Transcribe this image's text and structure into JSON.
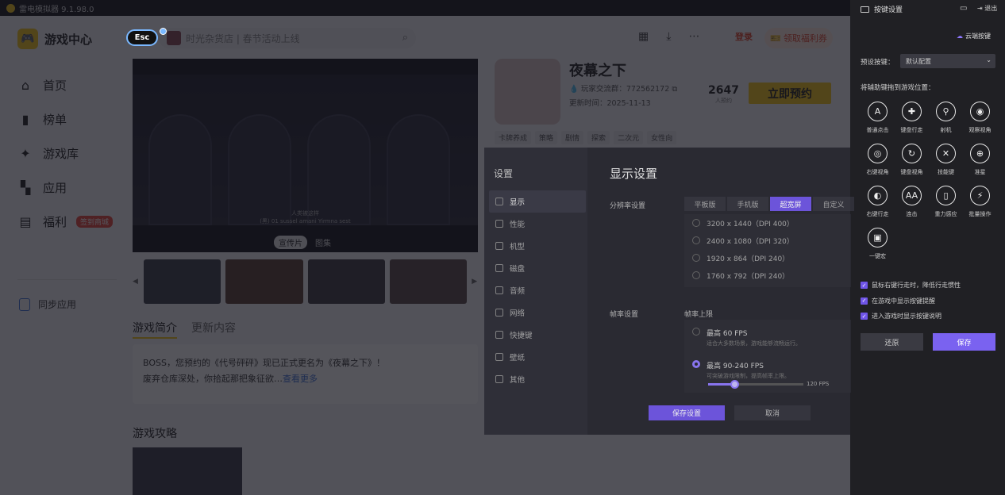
{
  "window": {
    "title": "雷电模拟器 9.1.98.0"
  },
  "header": {
    "brand": "游戏中心",
    "esc": "Esc",
    "search_placeholder": "时光杂货店 | 春节活动上线",
    "login": "登录",
    "welfare": "领取福利券"
  },
  "nav": {
    "items": [
      {
        "label": "首页",
        "icon": "home-icon"
      },
      {
        "label": "榜单",
        "icon": "ranking-icon"
      },
      {
        "label": "游戏库",
        "icon": "gamepad-icon"
      },
      {
        "label": "应用",
        "icon": "apps-icon"
      },
      {
        "label": "福利",
        "icon": "gift-icon",
        "badge": "签到商城"
      }
    ],
    "sync": "同步应用"
  },
  "media": {
    "caption_line1": "人类被这样",
    "caption_line2": "(黑) 01 sussel amani Yirmna sest",
    "tab_video": "宣传片",
    "tab_gallery": "图集"
  },
  "intro": {
    "tab_intro": "游戏简介",
    "tab_update": "更新内容",
    "line1": "BOSS，您预约的《代号砰砰》现已正式更名为《夜幕之下》！",
    "line2": "废弃仓库深处，你拾起那把象征欲…",
    "more": "查看更多"
  },
  "guide": {
    "title": "游戏攻略"
  },
  "game": {
    "title": "夜幕之下",
    "group": "玩家交流群：772562172",
    "updated": "更新时间：2025-11-13",
    "count": "2647",
    "count_label": "人预约",
    "reserve": "立即预约",
    "tags": [
      "卡牌养成",
      "策略",
      "剧情",
      "探索",
      "二次元",
      "女性向"
    ]
  },
  "settings_dialog": {
    "side_title": "设置",
    "menu": [
      "显示",
      "性能",
      "机型",
      "磁盘",
      "音频",
      "网络",
      "快捷键",
      "壁纸",
      "其他"
    ],
    "heading": "显示设置",
    "resolution_label": "分辨率设置",
    "res_tabs": [
      "平板版",
      "手机版",
      "超宽屏",
      "自定义"
    ],
    "res_active": 2,
    "res_options": [
      "3200 x 1440（DPI 400）",
      "2400 x 1080（DPI 320）",
      "1920 x 864（DPI 240）",
      "1760 x 792（DPI 240）"
    ],
    "fps_label": "帧率设置",
    "fps_limit": "帧率上限",
    "fps_opt1": "最高 60 FPS",
    "fps_opt1_sub": "适合大多数场景，游戏能够流畅运行。",
    "fps_opt2": "最高 90-240 FPS",
    "fps_opt2_sub": "可突破游戏限制，提高帧率上限。",
    "fps_value": "120 FPS",
    "save": "保存设置",
    "cancel": "取消"
  },
  "key_panel": {
    "title": "按键设置",
    "exit": "退出",
    "cloud": "云端按键",
    "preset_label": "预设按键：",
    "preset_value": "默认配置",
    "drag_hint": "将辅助键拖到游戏位置：",
    "keys": [
      {
        "label": "普通点击",
        "glyph": "A",
        "icon": "tap-icon"
      },
      {
        "label": "键盘行走",
        "glyph": "✚",
        "icon": "dpad-icon"
      },
      {
        "label": "射机",
        "glyph": "⚲",
        "icon": "shoot-icon"
      },
      {
        "label": "观察视角",
        "glyph": "◉",
        "icon": "eye-icon"
      },
      {
        "label": "右键视角",
        "glyph": "◎",
        "icon": "right-view-icon"
      },
      {
        "label": "键盘视角",
        "glyph": "↻",
        "icon": "keyboard-view-icon"
      },
      {
        "label": "技能键",
        "glyph": "✕",
        "icon": "skill-icon"
      },
      {
        "label": "准星",
        "glyph": "⊕",
        "icon": "crosshair-icon"
      },
      {
        "label": "右键行走",
        "glyph": "◐",
        "icon": "mouse-walk-icon"
      },
      {
        "label": "连击",
        "glyph": "AA",
        "icon": "combo-icon"
      },
      {
        "label": "重力感应",
        "glyph": "▯",
        "icon": "gravity-icon"
      },
      {
        "label": "批量操作",
        "glyph": "⚡",
        "icon": "batch-icon"
      },
      {
        "label": "一键宏",
        "glyph": "▣",
        "icon": "macro-icon"
      }
    ],
    "checks": [
      "鼠标右键行走时，降低行走惯性",
      "在游戏中显示按键提醒",
      "进入游戏时显示按键说明"
    ],
    "reset": "还原",
    "save": "保存"
  }
}
